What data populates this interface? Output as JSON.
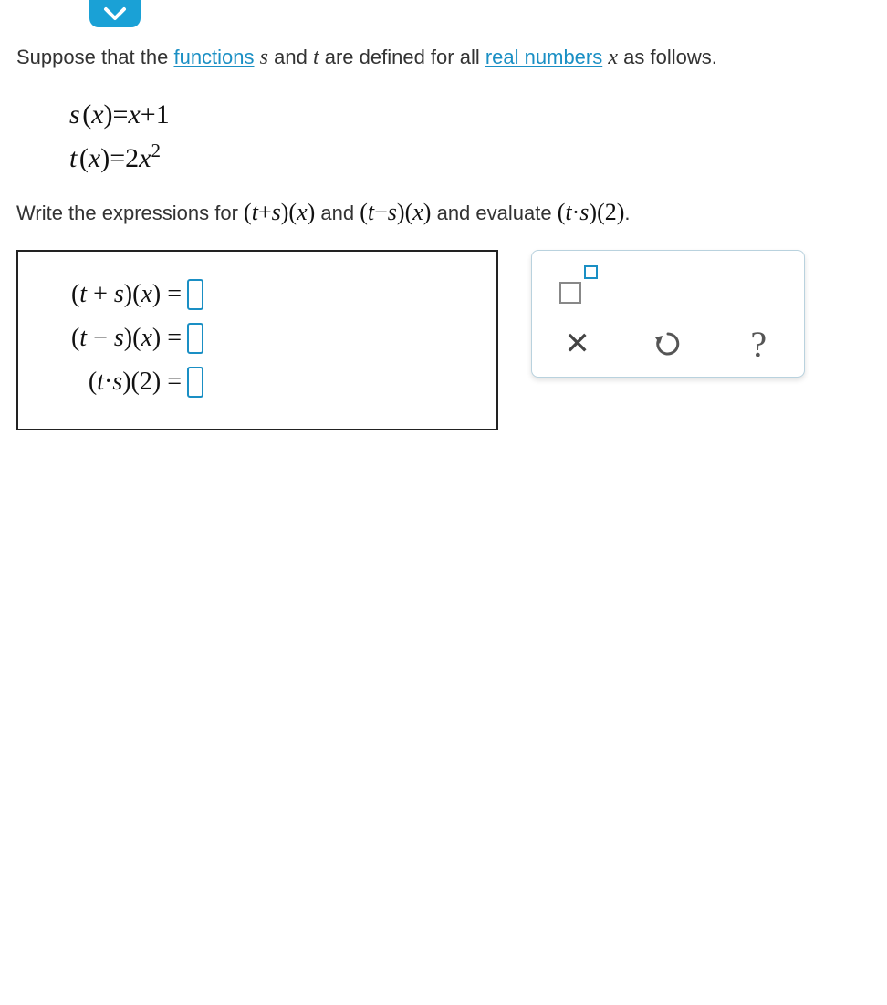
{
  "problem": {
    "intro_prefix": "Suppose that the ",
    "link_functions": "functions",
    "intro_mid1": " ",
    "var_s": "s",
    "intro_mid2": " and ",
    "var_t": "t",
    "intro_mid3": " are defined for all ",
    "link_realnumbers": "real numbers",
    "intro_mid4": " ",
    "var_x": "x",
    "intro_suffix": " as follows."
  },
  "definitions": {
    "s_def_lhs_var": "s",
    "s_def_lhs_paren_open": "(",
    "s_def_lhs_x": "x",
    "s_def_lhs_paren_close": ")",
    "s_def_eq": "=",
    "s_def_rhs": "x+1",
    "t_def_lhs_var": "t",
    "t_def_lhs_x": "x",
    "t_def_eq": "=",
    "t_def_rhs_coeff": "2",
    "t_def_rhs_var": "x",
    "t_def_rhs_exp": "2"
  },
  "instruction": {
    "prefix": "Write the expressions for ",
    "expr1": "(t+s)(x)",
    "mid1": " and ",
    "expr2": "(t−s)(x)",
    "mid2": " and evaluate ",
    "expr3": "(t·s)(2)",
    "suffix": "."
  },
  "answers": {
    "row1_label": "(t + s)(x) = ",
    "row2_label": "(t − s)(x) = ",
    "row3_label": "(t·s)(2) = "
  },
  "tools": {
    "superscript": "superscript",
    "clear": "clear",
    "undo": "undo",
    "help": "help"
  }
}
